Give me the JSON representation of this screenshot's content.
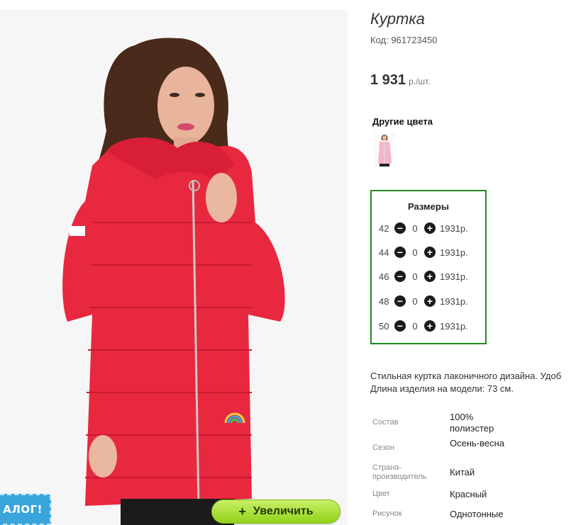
{
  "product": {
    "title": "Куртка",
    "code": "Код: 961723450",
    "price_value": "1 931",
    "price_unit": "р./шт."
  },
  "other_colors": {
    "title": "Другие цвета",
    "thumbnails": [
      "pink-jacket-thumbnail"
    ]
  },
  "sizes": {
    "title": "Размеры",
    "rows": [
      {
        "size": "42",
        "qty": "0",
        "price": "1931р."
      },
      {
        "size": "44",
        "qty": "0",
        "price": "1931р."
      },
      {
        "size": "46",
        "qty": "0",
        "price": "1931р."
      },
      {
        "size": "48",
        "qty": "0",
        "price": "1931р."
      },
      {
        "size": "50",
        "qty": "0",
        "price": "1931р."
      }
    ],
    "minus_icon": "minus-circle-icon",
    "plus_icon": "plus-circle-icon"
  },
  "description": {
    "line1": "Стильная куртка лаконичного дизайна. Удоб",
    "line2": "Длина изделия на модели: 73 см."
  },
  "properties": [
    {
      "label": "Состав",
      "value": "100% полиэстер"
    },
    {
      "label": "Сезон",
      "value": "Осень-весна"
    },
    {
      "label": "Страна-производитель",
      "value": "Китай"
    },
    {
      "label": "Цвет",
      "value": "Красный"
    },
    {
      "label": "Рисунок",
      "value": "Однотонные"
    }
  ],
  "buttons": {
    "zoom_label": "Увеличить",
    "zoom_icon": "+",
    "catalog_label": "АЛОГ!"
  },
  "colors": {
    "sizes_border": "#1f8a1f",
    "zoom_button": "#92d21c",
    "catalog_tab": "#3aa5dc",
    "jacket": "#e8283f"
  }
}
